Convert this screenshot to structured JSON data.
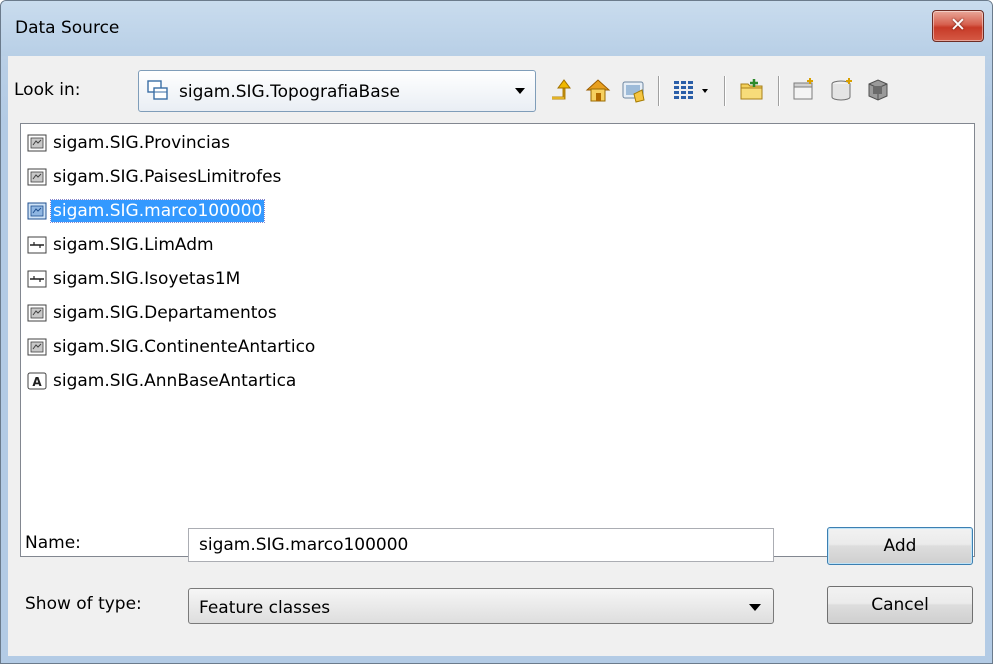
{
  "window": {
    "title": "Data Source",
    "close_symbol": "✕"
  },
  "toolbar": {
    "look_in_label": "Look in:",
    "look_in_value": "sigam.SIG.TopografiaBase",
    "buttons": [
      {
        "name": "up-one-level-icon"
      },
      {
        "name": "home-icon"
      },
      {
        "name": "connect-folder-icon"
      },
      {
        "name": "view-menu-icon"
      },
      {
        "name": "new-folder-icon"
      },
      {
        "name": "new-database-icon"
      },
      {
        "name": "new-feature-dataset-icon"
      },
      {
        "name": "catalog-icon"
      }
    ]
  },
  "list": {
    "items": [
      {
        "label": "sigam.SIG.Provincias",
        "icon": "polygon-feature-class-icon",
        "selected": false
      },
      {
        "label": "sigam.SIG.PaisesLimitrofes",
        "icon": "polygon-feature-class-icon",
        "selected": false
      },
      {
        "label": "sigam.SIG.marco100000",
        "icon": "polygon-feature-class-icon",
        "selected": true
      },
      {
        "label": "sigam.SIG.LimAdm",
        "icon": "line-feature-class-icon",
        "selected": false
      },
      {
        "label": "sigam.SIG.Isoyetas1M",
        "icon": "line-feature-class-icon",
        "selected": false
      },
      {
        "label": "sigam.SIG.Departamentos",
        "icon": "polygon-feature-class-icon",
        "selected": false
      },
      {
        "label": "sigam.SIG.ContinenteAntartico",
        "icon": "polygon-feature-class-icon",
        "selected": false
      },
      {
        "label": "sigam.SIG.AnnBaseAntartica",
        "icon": "annotation-class-icon",
        "selected": false
      }
    ]
  },
  "form": {
    "name_label": "Name:",
    "name_value": "sigam.SIG.marco100000",
    "type_label": "Show of type:",
    "type_value": "Feature classes",
    "add_label": "Add",
    "cancel_label": "Cancel"
  },
  "colors": {
    "selection": "#3399ff",
    "titlebar": "#b9cfe6",
    "close": "#c73a27"
  }
}
